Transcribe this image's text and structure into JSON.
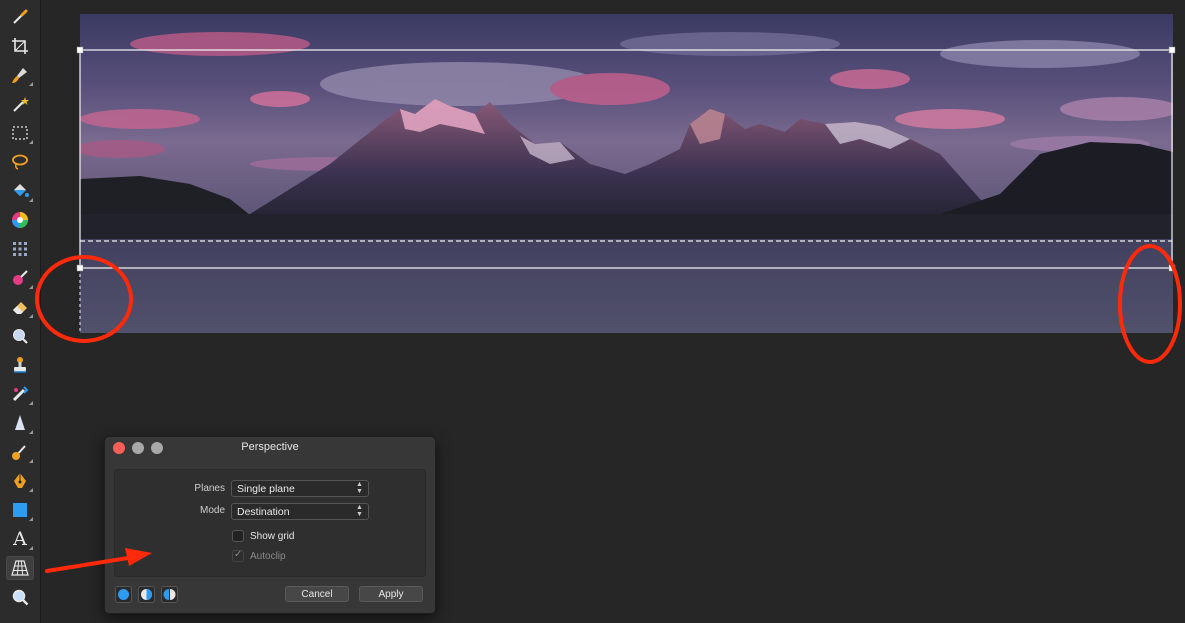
{
  "toolbar": {
    "tools": [
      {
        "name": "color-picker-tool-icon"
      },
      {
        "name": "crop-tool-icon"
      },
      {
        "name": "paint-brush-tool-icon"
      },
      {
        "name": "magic-wand-tool-icon"
      },
      {
        "name": "rectangle-marquee-tool-icon"
      },
      {
        "name": "lasso-tool-icon"
      },
      {
        "name": "flood-fill-tool-icon"
      },
      {
        "name": "color-wheel-tool-icon"
      },
      {
        "name": "mesh-warp-tool-icon"
      },
      {
        "name": "color-replace-brush-tool-icon"
      },
      {
        "name": "eraser-tool-icon"
      },
      {
        "name": "blur-tool-icon"
      },
      {
        "name": "clone-stamp-tool-icon"
      },
      {
        "name": "healing-brush-tool-icon"
      },
      {
        "name": "sharpen-tool-icon"
      },
      {
        "name": "smudge-brush-tool-icon"
      },
      {
        "name": "pen-tool-icon"
      },
      {
        "name": "rectangle-shape-tool-icon"
      },
      {
        "name": "text-tool-icon",
        "glyph": "A"
      },
      {
        "name": "perspective-tool-icon"
      },
      {
        "name": "zoom-tool-icon"
      }
    ]
  },
  "dialog": {
    "title": "Perspective",
    "planes_label": "Planes",
    "planes_value": "Single plane",
    "mode_label": "Mode",
    "mode_value": "Destination",
    "show_grid_label": "Show grid",
    "show_grid_checked": false,
    "autoclip_label": "Autoclip",
    "autoclip_checked": true,
    "cancel_label": "Cancel",
    "apply_label": "Apply",
    "check_glyph": "✓",
    "select_arrows": "▲▼"
  },
  "colors": {
    "annotation": "#ff2a0a",
    "close_button": "#fd5f57",
    "accent": "#2d9bf0"
  }
}
